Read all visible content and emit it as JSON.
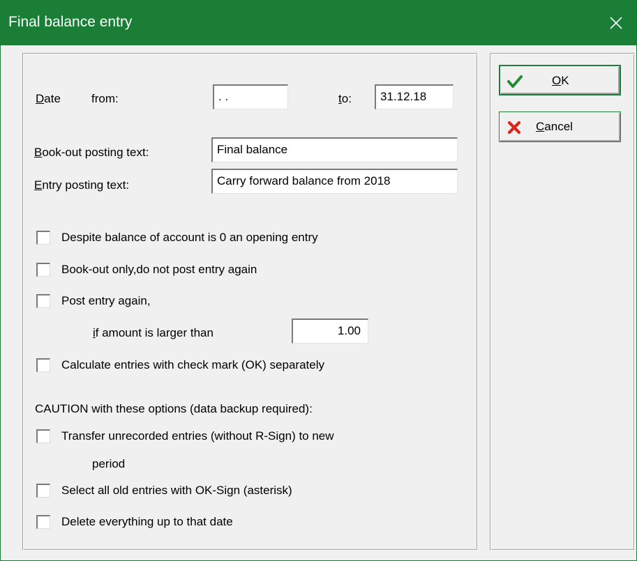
{
  "window": {
    "title": "Final balance entry",
    "close_glyph": "✕"
  },
  "date": {
    "label_prefix": "",
    "label_mnemonic": "D",
    "label_rest": "ate",
    "from_label": "from:",
    "from_value": "  .  .",
    "to_mnemonic": "t",
    "to_rest": "o:",
    "to_value": "31.12.18"
  },
  "bookout": {
    "label_mnemonic": "B",
    "label_rest": "ook-out posting text:",
    "value": "Final balance"
  },
  "entry": {
    "label_mnemonic": "E",
    "label_rest": "ntry posting text:",
    "value": "Carry forward balance from 2018"
  },
  "options": {
    "despite_balance": "Despite balance of account is 0 an opening entry",
    "bookout_only": "Book-out only,do not post entry again",
    "post_again": "Post entry again,",
    "amount_label_mnemonic": "i",
    "amount_label_rest": "f amount is larger than",
    "amount_value": "1.00",
    "calculate_separately": "Calculate entries with check mark (OK) separately"
  },
  "caution": {
    "heading": "CAUTION with these options (data backup required):",
    "transfer_line1": "Transfer unrecorded entries (without R-Sign) to new",
    "transfer_line2": "period",
    "select_all": "Select all old entries with OK-Sign (asterisk)",
    "delete_all": "Delete everything up to that date"
  },
  "buttons": {
    "ok_mnemonic": "O",
    "ok_rest": "K",
    "cancel_mnemonic": "C",
    "cancel_rest": "ancel"
  },
  "icons": {
    "ok": "check-icon",
    "cancel": "x-cross-icon",
    "close": "close-icon"
  },
  "colors": {
    "titlebar": "#1a7e37",
    "check_green": "#1f8a2e",
    "cancel_red": "#d9261c"
  }
}
